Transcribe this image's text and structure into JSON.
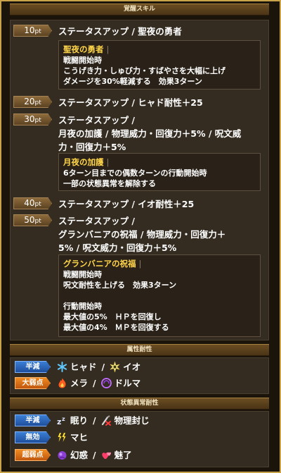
{
  "awakening": {
    "header": "覚醒スキル",
    "skills": [
      {
        "pt": "10",
        "unit": "pt",
        "title": "ステータスアップ / 聖夜の勇者",
        "desc_name": "聖夜の勇者",
        "desc_text": "戦闘開始時\nこうげき力・しゅび力・すばやさを大幅に上げ\nダメージを30%軽減する　効果3ターン"
      },
      {
        "pt": "20",
        "unit": "pt",
        "title": "ステータスアップ / ヒャド耐性＋25"
      },
      {
        "pt": "30",
        "unit": "pt",
        "title": "ステータスアップ /\n月夜の加護 / 物理威力・回復力＋5% / 呪文威\n力・回復力＋5%",
        "desc_name": "月夜の加護",
        "desc_text": "6ターン目までの偶数ターンの行動開始時\n一部の状態異常を解除する"
      },
      {
        "pt": "40",
        "unit": "pt",
        "title": "ステータスアップ / イオ耐性＋25"
      },
      {
        "pt": "50",
        "unit": "pt",
        "title": "ステータスアップ /\nグランバニアの祝福 / 物理威力・回復力＋\n5% / 呪文威力・回復力＋5%",
        "desc_name": "グランバニアの祝福",
        "desc_text": "戦闘開始時\n呪文耐性を上げる　効果3ターン\n\n行動開始時\n最大値の5%　ＨＰを回復し\n最大値の4%　ＭＰを回復する"
      }
    ]
  },
  "element_resistance": {
    "header": "属性耐性",
    "rows": [
      {
        "badge": "半減",
        "color": "#2f6cc4",
        "items": [
          {
            "icon": "ice-icon",
            "label": "ヒャド"
          },
          {
            "icon": "explosion-icon",
            "label": "イオ"
          }
        ]
      },
      {
        "badge": "大弱点",
        "color": "#e0741a",
        "items": [
          {
            "icon": "fire-icon",
            "label": "メラ"
          },
          {
            "icon": "darkness-icon",
            "label": "ドルマ"
          }
        ]
      }
    ]
  },
  "status_resistance": {
    "header": "状態異常耐性",
    "rows": [
      {
        "badge": "半減",
        "color": "#2f6cc4",
        "items": [
          {
            "icon": "sleep-icon",
            "label": "眠り"
          },
          {
            "icon": "physical-seal-icon",
            "label": "物理封じ"
          }
        ]
      },
      {
        "badge": "無効",
        "color": "#2f6cc4",
        "items": [
          {
            "icon": "paralysis-icon",
            "label": "マヒ"
          }
        ]
      },
      {
        "badge": "超弱点",
        "color": "#e0741a",
        "items": [
          {
            "icon": "confusion-icon",
            "label": "幻惑"
          },
          {
            "icon": "charm-icon",
            "label": "魅了"
          }
        ]
      }
    ]
  }
}
